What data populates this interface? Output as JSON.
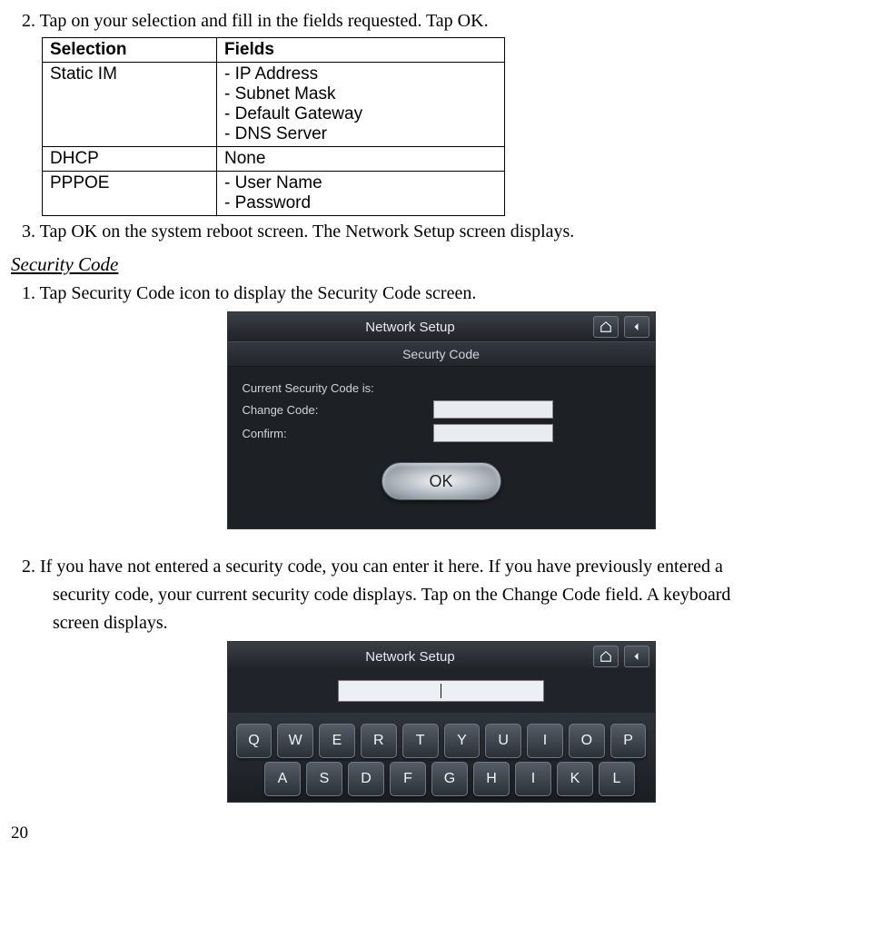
{
  "steps": {
    "s2": "2. Tap on your selection and fill in the fields requested. Tap OK.",
    "s3": "3. Tap OK on the system reboot screen. The Network Setup screen displays.",
    "sec1": "1. Tap Security Code icon to display the Security Code screen.",
    "sec2a": "2. If you have not entered a security code, you can enter it here. If you have previously entered a",
    "sec2b": "security code, your current security code displays. Tap on the Change Code field. A keyboard",
    "sec2c": "screen displays."
  },
  "table": {
    "h1": "Selection",
    "h2": "Fields",
    "r1c1": "Static IM",
    "r1f1": "- IP Address",
    "r1f2": "- Subnet Mask",
    "r1f3": "- Default Gateway",
    "r1f4": "- DNS Server",
    "r2c1": "DHCP",
    "r2c2": "None",
    "r3c1": "PPPOE",
    "r3f1": "- User Name",
    "r3f2": "- Password"
  },
  "heading": "Security Code",
  "mock1": {
    "title": "Network Setup",
    "subtitle": "Securty Code",
    "lbl1": "Current Security Code is:",
    "lbl2": "Change Code:",
    "lbl3": "Confirm:",
    "ok": "OK"
  },
  "mock2": {
    "title": "Network Setup",
    "row1": [
      "Q",
      "W",
      "E",
      "R",
      "T",
      "Y",
      "U",
      "I",
      "O",
      "P"
    ],
    "row2": [
      "A",
      "S",
      "D",
      "F",
      "G",
      "H",
      "I",
      "K",
      "L"
    ]
  },
  "pageNumber": "20"
}
